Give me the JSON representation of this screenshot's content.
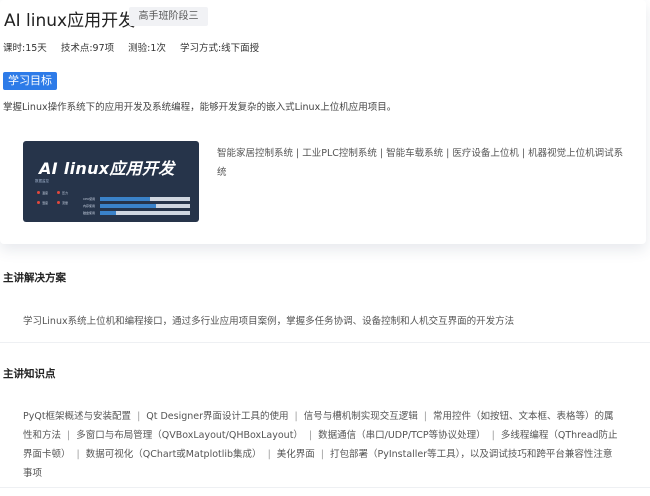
{
  "course": {
    "title": "AI linux应用开发",
    "stage": "高手班阶段三",
    "meta": [
      "课时:15天",
      "技术点:97项",
      "测验:1次",
      "学习方式:线下面授"
    ]
  },
  "goal": {
    "tag": "学习目标",
    "description": "掌握Linux操作系统下的应用开发及系统编程，能够开发复杂的嵌入式Linux上位机应用项目。"
  },
  "thumbnail": {
    "title": "AI linux应用开发",
    "labels": [
      "数据监控",
      "温度",
      "压力",
      "湿度",
      "流量",
      "CPU使用",
      "内存使用",
      "磁盘使用"
    ],
    "bars": [
      {
        "label": "CPU使用",
        "value": 0.55
      },
      {
        "label": "内存使用",
        "value": 0.62
      },
      {
        "label": "磁盘使用",
        "value": 0.18
      }
    ]
  },
  "applications": "智能家居控制系统 | 工业PLC控制系统 | 智能车载系统 | 医疗设备上位机 | 机器视觉上位机调试系统",
  "solution": {
    "heading": "主讲解决方案",
    "text": "学习Linux系统上位机和编程接口，通过多行业应用项目案例，掌握多任务协调、设备控制和人机交互界面的开发方法"
  },
  "knowledge": {
    "heading": "主讲知识点",
    "items": [
      "PyQt框架概述与安装配置",
      "Qt Designer界面设计工具的使用",
      "信号与槽机制实现交互逻辑",
      "常用控件（如按钮、文本框、表格等）的属性和方法",
      "多窗口与布局管理（QVBoxLayout/QHBoxLayout）",
      "数据通信（串口/UDP/TCP等协议处理）",
      "多线程编程（QThread防止界面卡顿）",
      "数据可视化（QChart或Matplotlib集成）",
      "美化界面",
      "打包部署（PyInstaller等工具），以及调试技巧和跨平台兼容性注意事项"
    ]
  }
}
